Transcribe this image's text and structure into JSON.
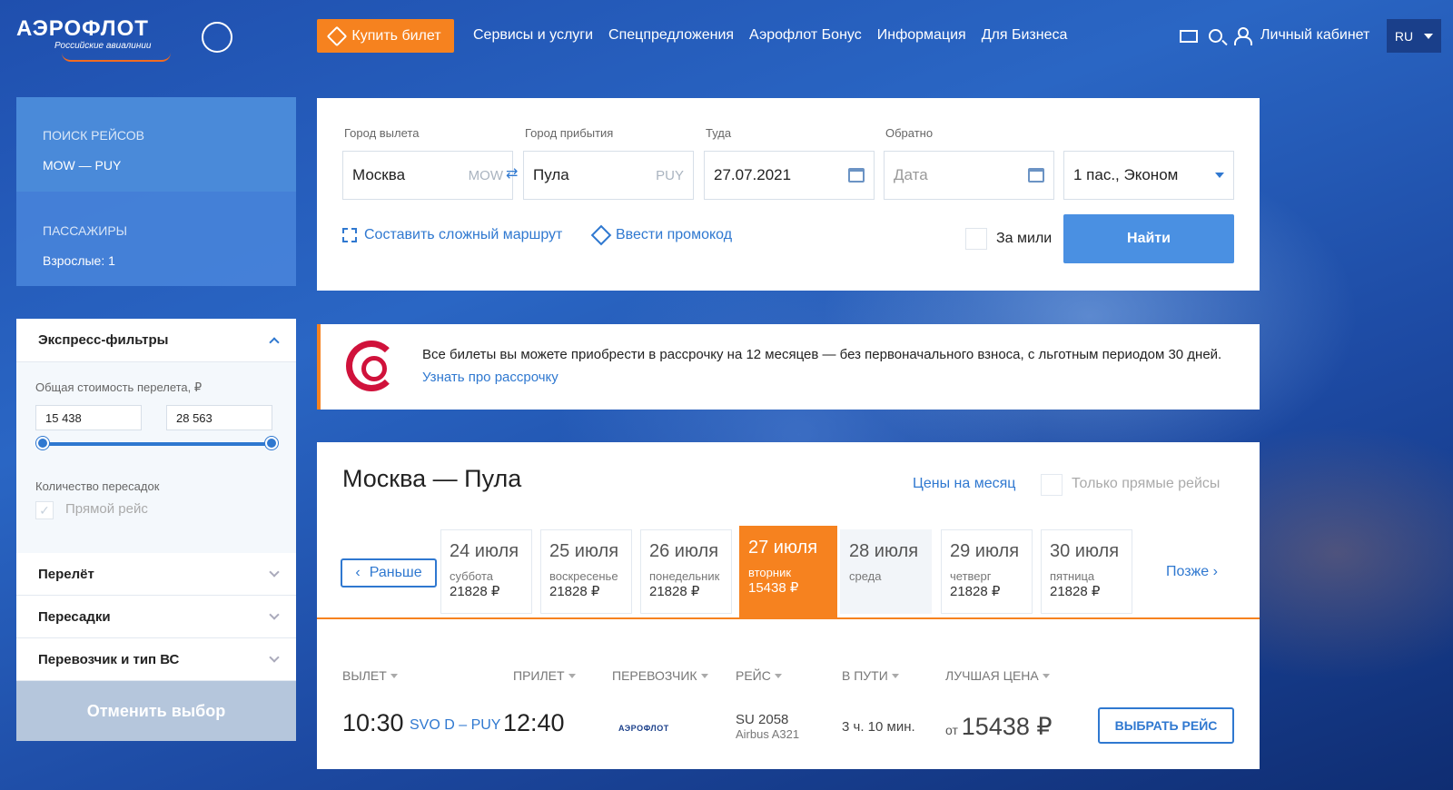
{
  "header": {
    "logo_text": "АЭРОФЛОТ",
    "logo_subtitle": "Российские авиалинии",
    "buy_ticket": "Купить билет",
    "nav": [
      "Сервисы и услуги",
      "Спецпредложения",
      "Аэрофлот Бонус",
      "Информация",
      "Для Бизнеса"
    ],
    "cabinet": "Личный кабинет",
    "language": "RU"
  },
  "summary": {
    "search_label": "ПОИСК РЕЙСОВ",
    "route": "MOW — PUY",
    "passengers_label": "ПАССАЖИРЫ",
    "passengers_value": "Взрослые: 1"
  },
  "filters": {
    "title": "Экспресс-фильтры",
    "price_label": "Общая стоимость перелета, ₽",
    "price_min": "15 438",
    "price_max": "28 563",
    "price_range_fraction": [
      0,
      1
    ],
    "transfers_label": "Количество пересадок",
    "direct_label": "Прямой рейс",
    "sections": [
      "Перелёт",
      "Пересадки",
      "Перевозчик и тип ВС"
    ],
    "reset": "Отменить выбор"
  },
  "search": {
    "from_label": "Город вылета",
    "from_value": "Москва",
    "from_code": "MOW",
    "to_label": "Город прибытия",
    "to_value": "Пула",
    "to_code": "PUY",
    "depart_label": "Туда",
    "depart_value": "27.07.2021",
    "return_label": "Обратно",
    "return_placeholder": "Дата",
    "passengers": "1 пас., Эконом",
    "complex_route": "Составить сложный маршрут",
    "promo_code": "Ввести промокод",
    "miles": "За мили",
    "find": "Найти"
  },
  "promo": {
    "text": "Все билеты вы можете приобрести в рассрочку на 12 месяцев — без первоначального взноса, с льготным периодом 30 дней.",
    "link": "Узнать про рассрочку"
  },
  "results": {
    "title": "Москва — Пула",
    "month_prices": "Цены на месяц",
    "direct_only": "Только прямые рейсы",
    "earlier": "Раньше",
    "later": "Позже",
    "days": [
      {
        "date": "24 июля",
        "weekday": "суббота",
        "price": "21828 ₽"
      },
      {
        "date": "25 июля",
        "weekday": "воскресенье",
        "price": "21828 ₽"
      },
      {
        "date": "26 июля",
        "weekday": "понедельник",
        "price": "21828 ₽"
      },
      {
        "date": "27 июля",
        "weekday": "вторник",
        "price": "15438 ₽"
      },
      {
        "date": "28 июля",
        "weekday": "среда",
        "price": ""
      },
      {
        "date": "29 июля",
        "weekday": "четверг",
        "price": "21828 ₽"
      },
      {
        "date": "30 июля",
        "weekday": "пятница",
        "price": "21828 ₽"
      }
    ],
    "columns": [
      "ВЫЛЕТ",
      "ПРИЛЕТ",
      "ПЕРЕВОЗЧИК",
      "РЕЙС",
      "В ПУТИ",
      "ЛУЧШАЯ ЦЕНА"
    ],
    "flight": {
      "depart": "10:30",
      "route": "SVO D – PUY",
      "arrive": "12:40",
      "carrier": "АЭРОФЛОТ",
      "number": "SU 2058",
      "aircraft": "Airbus A321",
      "duration": "3 ч. 10 мин.",
      "price_prefix": "от",
      "price": "15438 ₽",
      "choose": "ВЫБРАТЬ РЕЙС"
    }
  },
  "colors": {
    "accent": "#f6821f",
    "primary": "#2f78d0",
    "brand_red": "#d0123b"
  }
}
